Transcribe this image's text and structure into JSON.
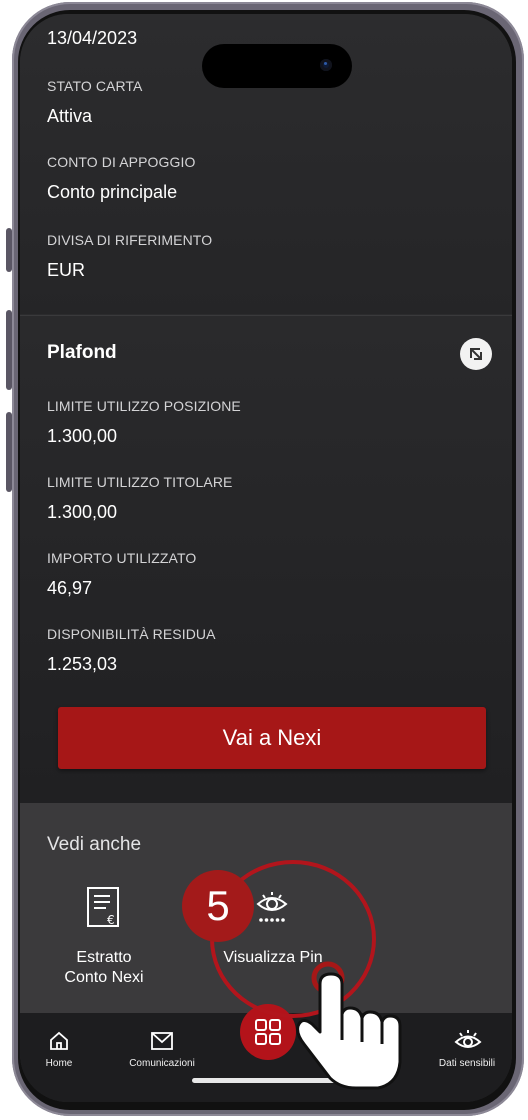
{
  "top_section": {
    "date": "13/04/2023",
    "stato_carta_label": "STATO CARTA",
    "stato_carta_value": "Attiva",
    "conto_label": "CONTO DI APPOGGIO",
    "conto_value": "Conto principale",
    "divisa_label": "DIVISA DI RIFERIMENTO",
    "divisa_value": "EUR"
  },
  "plafond": {
    "title": "Plafond",
    "items": [
      {
        "label": "LIMITE UTILIZZO POSIZIONE",
        "value": "1.300,00"
      },
      {
        "label": "LIMITE UTILIZZO TITOLARE",
        "value": "1.300,00"
      },
      {
        "label": "IMPORTO UTILIZZATO",
        "value": "46,97"
      },
      {
        "label": "DISPONIBILITÀ RESIDUA",
        "value": "1.253,03"
      }
    ]
  },
  "cta": {
    "label": "Vai a Nexi"
  },
  "vedi_anche": {
    "title": "Vedi anche",
    "tiles": [
      {
        "line1": "Estratto",
        "line2": "Conto Nexi",
        "icon": "document-euro-icon"
      },
      {
        "line1": "Visualizza Pin",
        "icon": "eye-pin-icon"
      }
    ]
  },
  "nav": {
    "items": [
      {
        "label": "Home",
        "icon": "home-icon"
      },
      {
        "label": "Comunicazioni",
        "icon": "mail-icon"
      },
      {
        "label": "",
        "icon": "grid-icon"
      },
      {
        "label": "Dati sensibili",
        "icon": "eye-icon"
      }
    ]
  },
  "annotation": {
    "step": "5"
  },
  "colors": {
    "accent": "#a61717",
    "background": "#2b2b2d",
    "nav": "#1d1d1f"
  }
}
